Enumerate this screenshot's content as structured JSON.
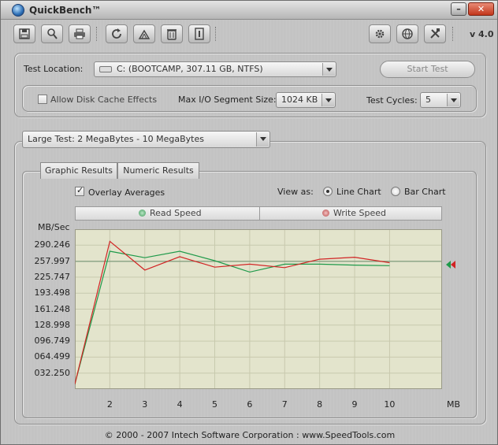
{
  "window": {
    "title": "QuickBench™",
    "version": "v 4.0"
  },
  "toolbar": {
    "left_icons": [
      "save-icon",
      "search-icon",
      "print-icon",
      "refresh-icon",
      "clean-icon",
      "trash-icon",
      "info-icon"
    ],
    "right_icons": [
      "gear-icon",
      "globe-icon",
      "tools-icon"
    ]
  },
  "settings": {
    "test_location_label": "Test Location:",
    "test_location_value": "C:  (BOOTCAMP, 307.11 GB, NTFS)",
    "start_button": "Start Test",
    "cache_label": "Allow Disk Cache Effects",
    "cache_checked": false,
    "segment_label": "Max I/O Segment Size:",
    "segment_value": "1024 KB",
    "cycles_label": "Test Cycles:",
    "cycles_value": "5"
  },
  "test_size": {
    "value": "Large Test:  2 MegaBytes - 10 MegaBytes"
  },
  "tabs": [
    "Graphic Results",
    "Numeric Results"
  ],
  "options": {
    "overlay_label": "Overlay Averages",
    "overlay_checked": true,
    "view_as_label": "View as:",
    "line_chart_label": "Line Chart",
    "bar_chart_label": "Bar Chart",
    "selected_view": "Line Chart"
  },
  "legend": {
    "read": "Read Speed",
    "write": "Write Speed"
  },
  "colors": {
    "read": "#1f9a4a",
    "write": "#d12424",
    "plot_bg": "#e3e4cc",
    "average_line": "#6e9070"
  },
  "chart_data": {
    "type": "line",
    "ylabel": "MB/Sec",
    "xlabel": "MB",
    "ylim": [
      0,
      322.496
    ],
    "y_ticks": [
      "290.246",
      "257.997",
      "225.747",
      "193.498",
      "161.248",
      "128.998",
      "096.749",
      "064.499",
      "032.250"
    ],
    "x_ticks": [
      "2",
      "3",
      "4",
      "5",
      "6",
      "7",
      "8",
      "9",
      "10"
    ],
    "xlim": [
      1,
      11.5
    ],
    "series": [
      {
        "name": "Read Speed",
        "x": [
          1,
          2,
          3,
          4,
          5,
          6,
          7,
          8,
          9,
          10
        ],
        "values": [
          10,
          278,
          265,
          278,
          259,
          236,
          252,
          252,
          250,
          249
        ]
      },
      {
        "name": "Write Speed",
        "x": [
          1,
          2,
          3,
          4,
          5,
          6,
          7,
          8,
          9,
          10
        ],
        "values": [
          10,
          298,
          240,
          267,
          246,
          252,
          245,
          262,
          266,
          255
        ]
      }
    ],
    "average_line": 257.5,
    "grid": true
  },
  "footer": {
    "text": "© 2000 - 2007  Intech Software Corporation   :   www.SpeedTools.com"
  }
}
